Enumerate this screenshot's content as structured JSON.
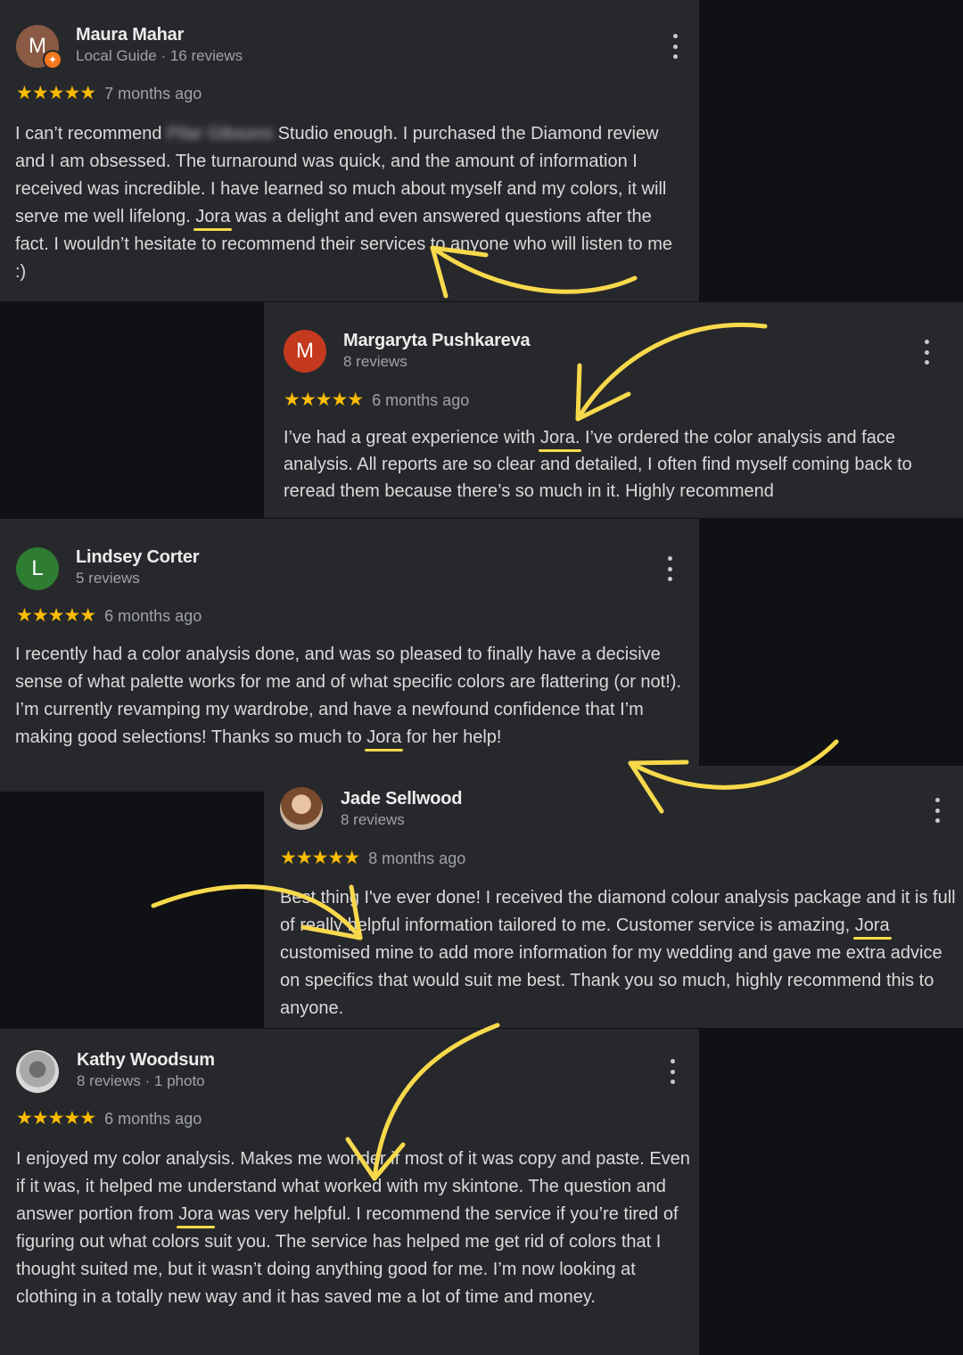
{
  "reviews": [
    {
      "initial": "M",
      "avatar_color": "#8a5a44",
      "name": "Maura Mahar",
      "meta": "Local Guide · 16 reviews",
      "stars": "★★★★★",
      "time": "7 months ago",
      "text_before_blur": "I can’t recommend ",
      "blurred_name": "Pilar Gibsons",
      "text_after_blur": " Studio enough. I purchased the Diamond review and I am obsessed. The turnaround was quick, and the amount of information I received was incredible. I have learned so much about myself and my colors, it will serve me well lifelong. ",
      "highlight": "Jora",
      "text_after_highlight": " was a delight and even answered questions after the fact. I wouldn’t hesitate to recommend their services to anyone who will listen to me :)"
    },
    {
      "initial": "M",
      "avatar_color": "#c5391f",
      "name": "Margaryta Pushkareva",
      "meta": "8 reviews",
      "stars": "★★★★★",
      "time": "6 months ago",
      "text_before": "I’ve had a great experience with ",
      "highlight": "Jora.",
      "text_after": " I’ve ordered the color analysis and face analysis. All reports are so clear and detailed, I often find myself coming back to reread them because there’s so much in it. Highly recommend"
    },
    {
      "initial": "L",
      "avatar_color": "#2e7d32",
      "name": "Lindsey Corter",
      "meta": "5 reviews",
      "stars": "★★★★★",
      "time": "6 months ago",
      "text_before": "I recently had a color analysis done, and was so pleased to finally have a decisive sense of what palette works for me and of what specific colors are flattering (or not!). I’m currently revamping my wardrobe, and have a newfound confidence that I’m making good selections! Thanks so much to ",
      "highlight": "Jora",
      "text_after": " for her help!"
    },
    {
      "name": "Jade Sellwood",
      "meta": "8 reviews",
      "stars": "★★★★★",
      "time": "8 months ago",
      "text_before": "Best thing I've ever done! I received the diamond colour analysis package and it is full of really helpful information tailored to me. Customer service is amazing, ",
      "highlight": "Jora",
      "text_after": " customised mine to add more information for my wedding and gave me extra advice on specifics that would suit me best. Thank you so much, highly recommend this to anyone."
    },
    {
      "name": "Kathy Woodsum",
      "meta": "8 reviews · 1 photo",
      "stars": "★★★★★",
      "time": "6 months ago",
      "text_before": "I enjoyed my color analysis. Makes me wonder if most of it was copy and paste. Even if it was, it helped me understand what worked with my skintone. The question and answer portion from ",
      "highlight": "Jora",
      "text_after": " was very helpful. I recommend the service if you’re tired of figuring out what colors suit you. The service has helped me get rid of colors that I thought suited me, but it wasn’t doing anything good for me. I’m now looking at clothing in a totally new way and it has saved me a lot of time and money."
    }
  ],
  "colors": {
    "background": "#101114",
    "card": "#27282c",
    "star": "#fbbc04",
    "annotation": "#f7d94c"
  }
}
